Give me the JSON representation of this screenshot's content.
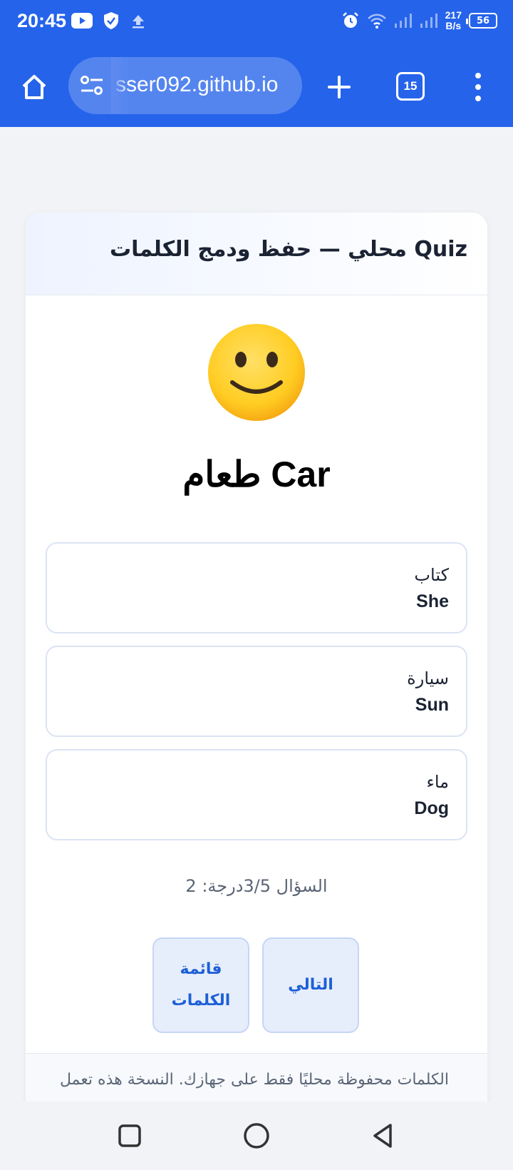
{
  "status": {
    "time": "20:45",
    "speed_value": "217",
    "speed_unit": "B/s",
    "battery": "56",
    "icons": [
      "youtube-icon",
      "shield-icon",
      "upload-icon",
      "alarm-icon",
      "wifi-icon",
      "signal-icon",
      "signal-icon",
      "battery-icon"
    ]
  },
  "browser": {
    "url": "sser092.github.io",
    "tab_count": "15",
    "icons": [
      "home-icon",
      "site-settings-icon",
      "plus-icon",
      "tabs-icon",
      "more-vert-icon"
    ]
  },
  "card": {
    "title": "Quiz محلي — حفظ ودمج الكلمات",
    "word": "طعام Car",
    "emoji_icon": "slightly-smiling-face-icon",
    "options": [
      {
        "arabic": "كتاب",
        "english": "She"
      },
      {
        "arabic": "سيارة",
        "english": "Sun"
      },
      {
        "arabic": "ماء",
        "english": "Dog"
      }
    ],
    "progress": "السؤال 3/5درجة: 2",
    "buttons": {
      "next": "التالي",
      "word_list": "قائمة الكلمات"
    },
    "footer": "الكلمات محفوظة محليًا فقط على جهازك. النسخة هذه تعمل"
  },
  "colors": {
    "brand": "#2563eb",
    "button_bg": "#e6edfb",
    "button_text": "#1d5fd6"
  },
  "navbar": {
    "icons": [
      "recents-icon",
      "home-circle-icon",
      "back-icon"
    ]
  }
}
